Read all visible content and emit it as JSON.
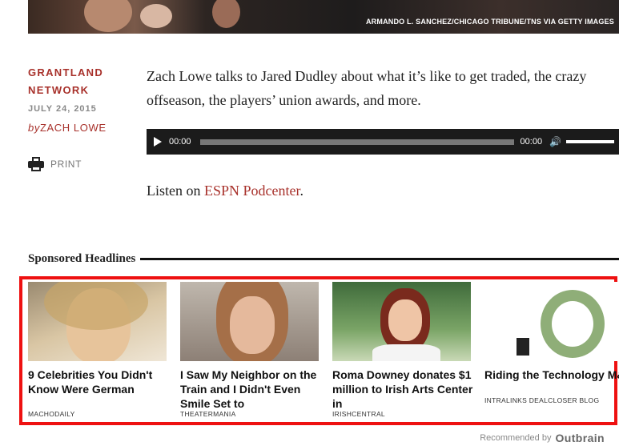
{
  "hero": {
    "credit": "ARMANDO L. SANCHEZ/CHICAGO TRIBUNE/TNS VIA GETTY IMAGES"
  },
  "meta": {
    "network_line1": "GRANTLAND",
    "network_line2": "NETWORK",
    "date": "JULY 24, 2015",
    "by_prefix": "by",
    "author": "ZACH LOWE",
    "print_label": "PRINT"
  },
  "article": {
    "description": "Zach Lowe talks to Jared Dudley about what it’s like to get traded, the crazy offseason, the players’ union awards, and more.",
    "listen_prefix": "Listen on ",
    "listen_link": "ESPN Podcenter",
    "listen_suffix": "."
  },
  "player": {
    "current_time": "00:00",
    "duration": "00:00",
    "progress": 0
  },
  "sponsored": {
    "heading": "Sponsored Headlines",
    "cards": [
      {
        "title": "9 Celebrities You Didn't Know Were German",
        "source": "MACHODAILY"
      },
      {
        "title": "I Saw My Neighbor on the Train and I Didn't Even Smile Set to",
        "source": "THEATERMANIA"
      },
      {
        "title": "Roma Downey donates $1 million to Irish Arts Center in",
        "source": "IRISHCENTRAL"
      },
      {
        "title": "Riding the Technology M&A Wave",
        "source": "INTRALINKS DEALCLOSER BLOG"
      }
    ],
    "recommended_by": "Recommended by",
    "outbrain": "Outbrain"
  },
  "colors": {
    "accent": "#a8312b",
    "highlight_border": "#ee1111",
    "player_bg": "#1b1b1b"
  }
}
